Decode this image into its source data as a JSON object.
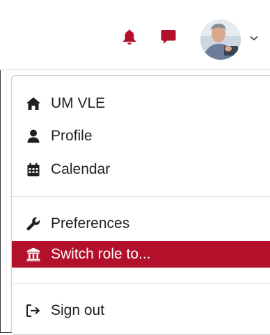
{
  "colors": {
    "accent": "#b3102b",
    "text": "#1d2125",
    "active_text": "#ffffff"
  },
  "header": {
    "icons": [
      "bell-icon",
      "chat-icon",
      "avatar",
      "chevron-down-icon"
    ]
  },
  "menu": {
    "items": [
      {
        "label": "UM VLE",
        "icon": "home-icon"
      },
      {
        "label": "Profile",
        "icon": "user-icon"
      },
      {
        "label": "Calendar",
        "icon": "calendar-icon"
      },
      {
        "label": "Preferences",
        "icon": "wrench-icon"
      },
      {
        "label": "Switch role to...",
        "icon": "institution-icon",
        "active": true
      },
      {
        "label": "Sign out",
        "icon": "sign-out-icon"
      }
    ]
  }
}
